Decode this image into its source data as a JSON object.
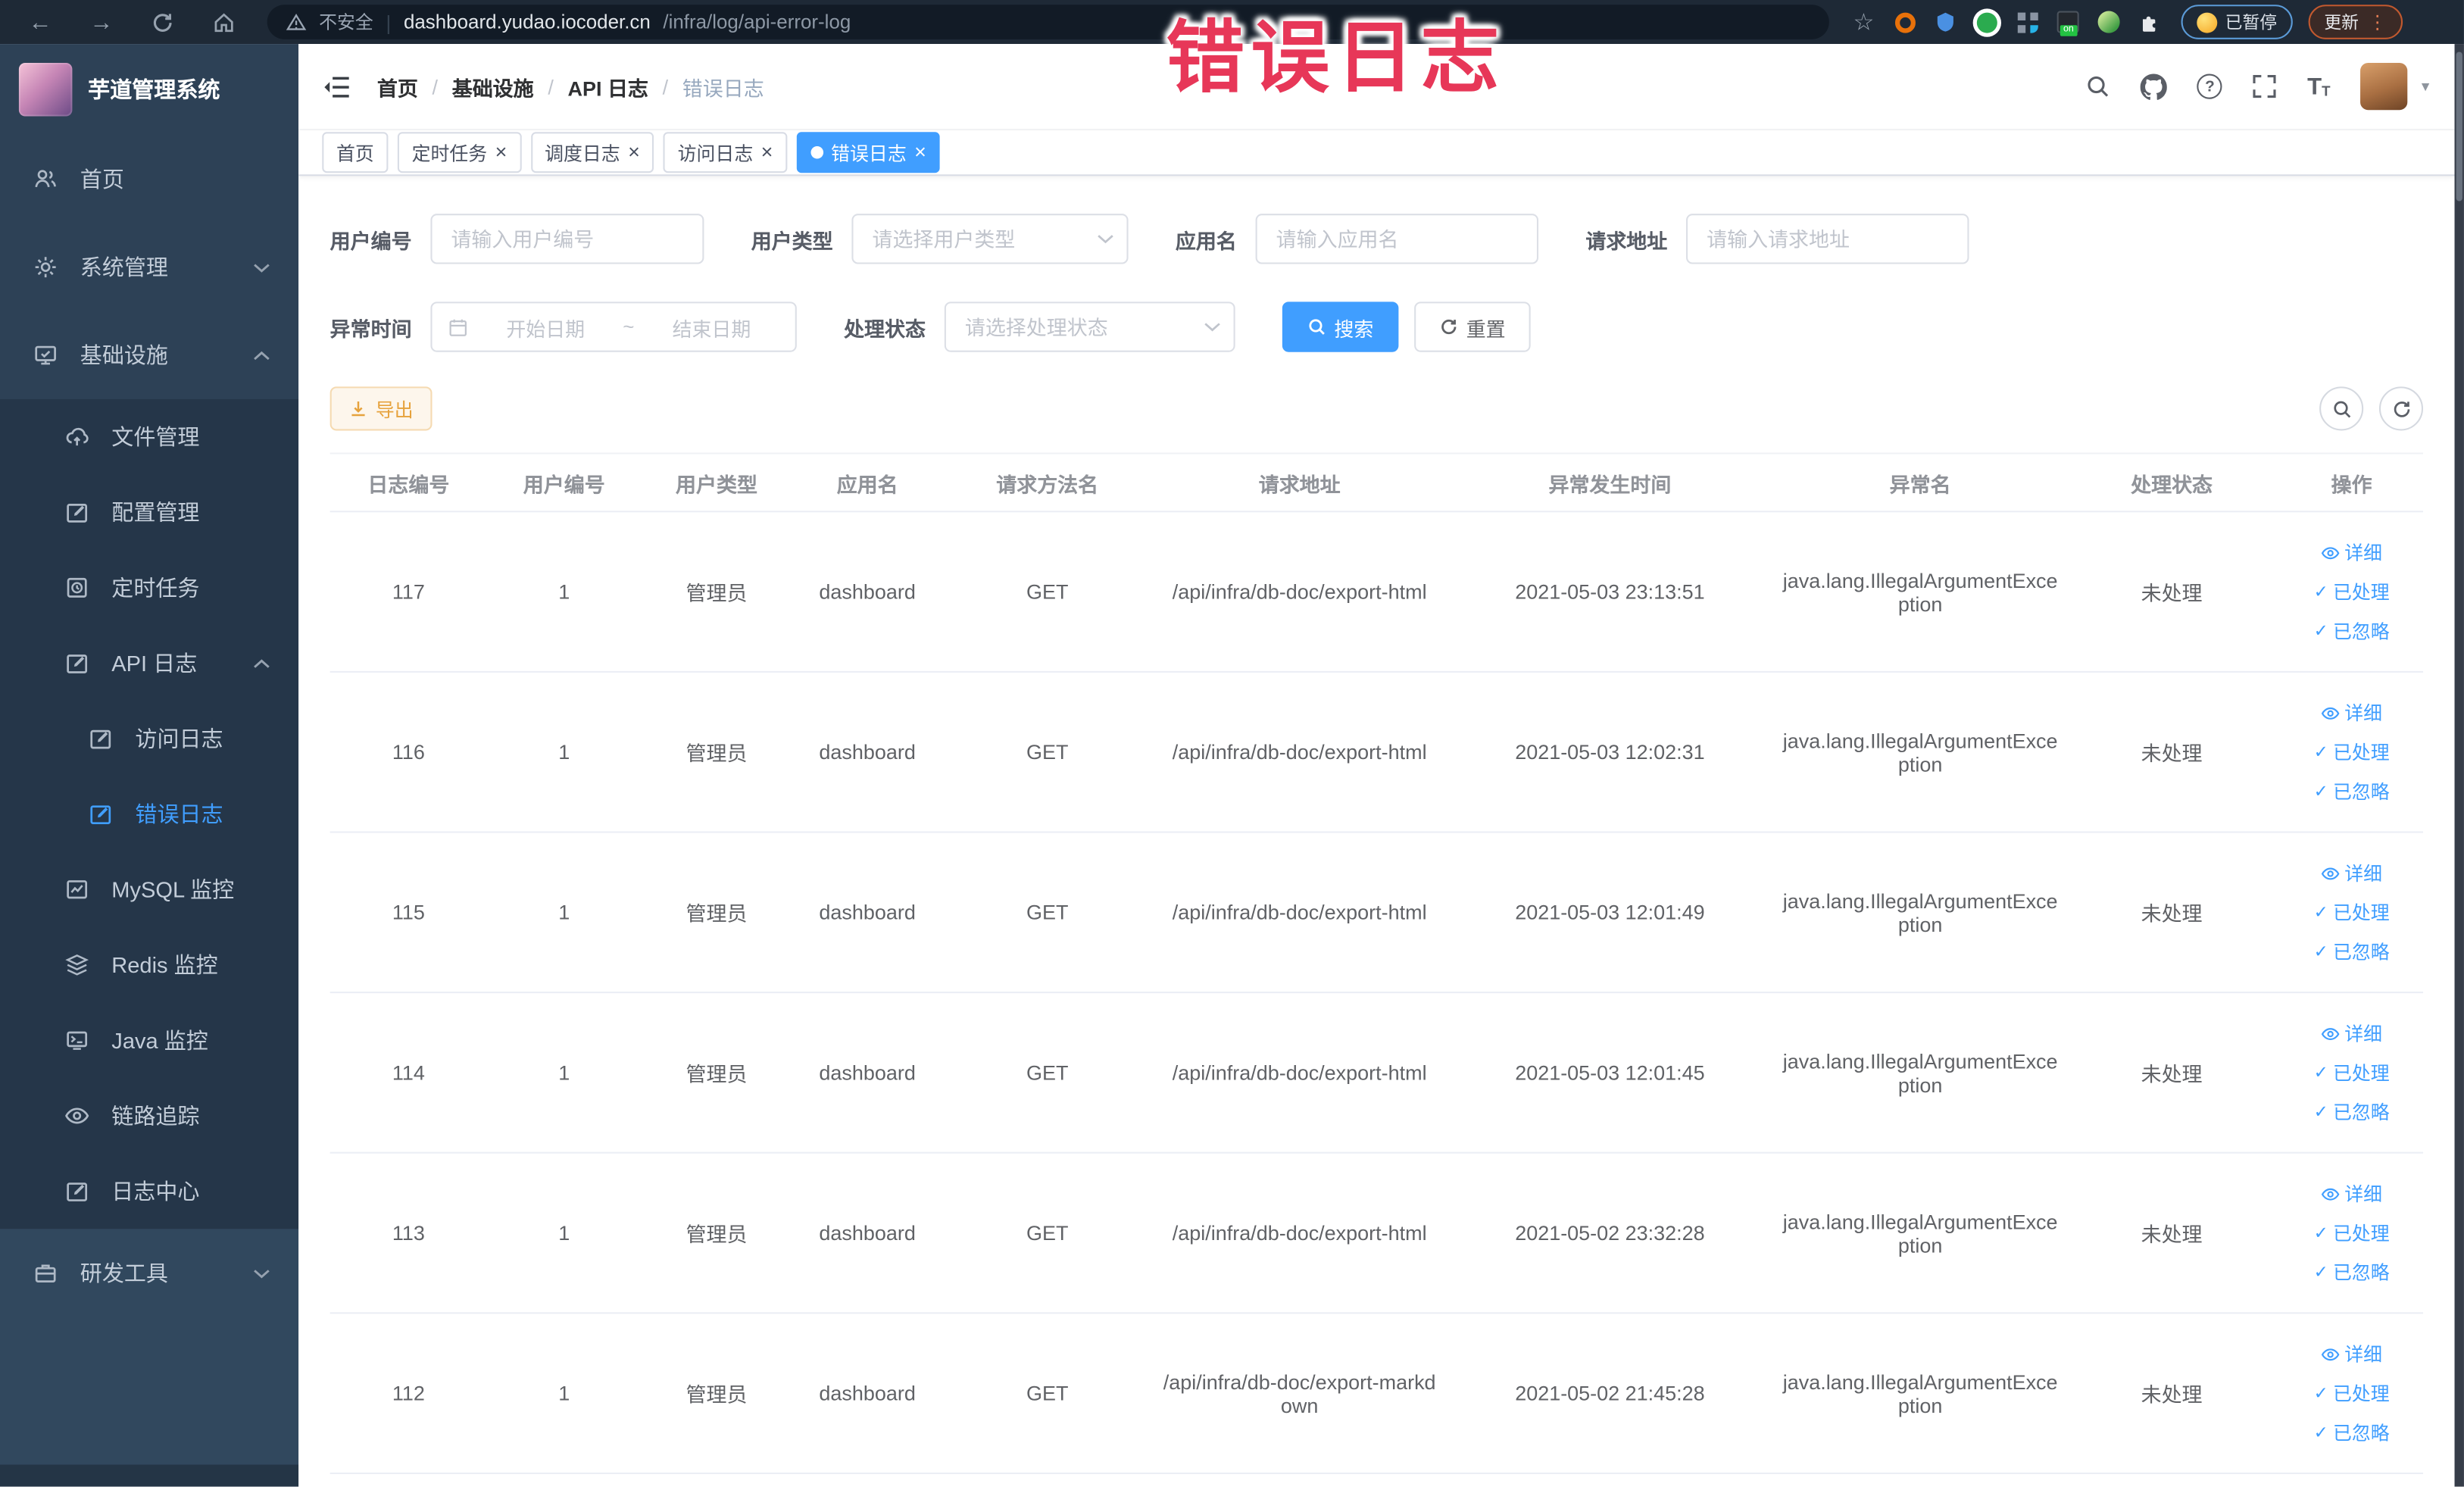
{
  "colors": {
    "primary": "#409eff",
    "warning_text": "#e6a23c",
    "overlay_pink": "#e73758",
    "sidebar_bg": "#2d4156",
    "submenu_bg": "#253649",
    "browser_bar_bg": "#1e2936"
  },
  "icons": {
    "back_arrow": "←",
    "forward_arrow": "→",
    "star": "☆",
    "url_separator": "|",
    "kebab": "⋮",
    "close": "×",
    "check": "✓",
    "caret_down": "▾",
    "question": "?",
    "font_size": "T",
    "range_separator_glyph": "~"
  },
  "browser": {
    "security_label": "不安全",
    "url_domain": "dashboard.yudao.iocoder.cn",
    "url_path": "/infra/log/api-error-log",
    "paused_badge": "已暂停",
    "update_button": "更新"
  },
  "overlay_title": "错误日志",
  "sidebar": {
    "brand": "芋道管理系统",
    "items": [
      {
        "label": "首页"
      },
      {
        "label": "系统管理"
      },
      {
        "label": "基础设施"
      },
      {
        "label": "文件管理"
      },
      {
        "label": "配置管理"
      },
      {
        "label": "定时任务"
      },
      {
        "label": "API 日志"
      },
      {
        "label": "访问日志"
      },
      {
        "label": "错误日志"
      },
      {
        "label": "MySQL 监控"
      },
      {
        "label": "Redis 监控"
      },
      {
        "label": "Java 监控"
      },
      {
        "label": "链路追踪"
      },
      {
        "label": "日志中心"
      },
      {
        "label": "研发工具"
      }
    ]
  },
  "navbar": {
    "breadcrumb": [
      "首页",
      "基础设施",
      "API 日志",
      "错误日志"
    ],
    "separator": "/"
  },
  "tabs": [
    {
      "label": "首页"
    },
    {
      "label": "定时任务"
    },
    {
      "label": "调度日志"
    },
    {
      "label": "访问日志"
    },
    {
      "label": "错误日志"
    }
  ],
  "filters": {
    "user_id": {
      "label": "用户编号",
      "placeholder": "请输入用户编号"
    },
    "user_type": {
      "label": "用户类型",
      "placeholder": "请选择用户类型"
    },
    "app_name": {
      "label": "应用名",
      "placeholder": "请输入应用名"
    },
    "request_url": {
      "label": "请求地址",
      "placeholder": "请输入请求地址"
    },
    "exception_time": {
      "label": "异常时间",
      "start_placeholder": "开始日期",
      "separator": "~",
      "end_placeholder": "结束日期"
    },
    "process_status": {
      "label": "处理状态",
      "placeholder": "请选择处理状态"
    },
    "search_button": "搜索",
    "reset_button": "重置"
  },
  "toolbar": {
    "export": "导出"
  },
  "table": {
    "headers": [
      "日志编号",
      "用户编号",
      "用户类型",
      "应用名",
      "请求方法名",
      "请求地址",
      "异常发生时间",
      "异常名",
      "处理状态",
      "操作"
    ],
    "actions": {
      "detail": "详细",
      "processed": "已处理",
      "ignored": "已忽略"
    },
    "rows": [
      {
        "id": "117",
        "user_id": "1",
        "user_type": "管理员",
        "app_name": "dashboard",
        "method": "GET",
        "url": "/api/infra/db-doc/export-html",
        "time": "2021-05-03 23:13:51",
        "exception": "java.lang.IllegalArgumentException",
        "status": "未处理"
      },
      {
        "id": "116",
        "user_id": "1",
        "user_type": "管理员",
        "app_name": "dashboard",
        "method": "GET",
        "url": "/api/infra/db-doc/export-html",
        "time": "2021-05-03 12:02:31",
        "exception": "java.lang.IllegalArgumentException",
        "status": "未处理"
      },
      {
        "id": "115",
        "user_id": "1",
        "user_type": "管理员",
        "app_name": "dashboard",
        "method": "GET",
        "url": "/api/infra/db-doc/export-html",
        "time": "2021-05-03 12:01:49",
        "exception": "java.lang.IllegalArgumentException",
        "status": "未处理"
      },
      {
        "id": "114",
        "user_id": "1",
        "user_type": "管理员",
        "app_name": "dashboard",
        "method": "GET",
        "url": "/api/infra/db-doc/export-html",
        "time": "2021-05-03 12:01:45",
        "exception": "java.lang.IllegalArgumentException",
        "status": "未处理"
      },
      {
        "id": "113",
        "user_id": "1",
        "user_type": "管理员",
        "app_name": "dashboard",
        "method": "GET",
        "url": "/api/infra/db-doc/export-html",
        "time": "2021-05-02 23:32:28",
        "exception": "java.lang.IllegalArgumentException",
        "status": "未处理"
      },
      {
        "id": "112",
        "user_id": "1",
        "user_type": "管理员",
        "app_name": "dashboard",
        "method": "GET",
        "url": "/api/infra/db-doc/export-markdown",
        "time": "2021-05-02 21:45:28",
        "exception": "java.lang.IllegalArgumentException",
        "status": "未处理"
      }
    ]
  }
}
